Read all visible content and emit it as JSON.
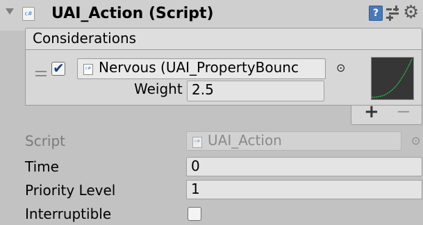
{
  "header": {
    "title": "UAI_Action (Script)",
    "script_icon_text": "c#",
    "icons": [
      "foldout-arrow-icon",
      "script-icon",
      "help-icon",
      "presets-icon",
      "gear-icon"
    ]
  },
  "considerations": {
    "header_label": "Considerations",
    "items": [
      {
        "enabled": true,
        "object_label": "Nervous (UAI_PropertyBounc",
        "object_icon_text": "c#",
        "weight_label": "Weight",
        "weight_value": "2.5"
      }
    ],
    "add_label": "+",
    "remove_label": "−"
  },
  "properties": {
    "script_label": "Script",
    "script_value": "UAI_Action",
    "time_label": "Time",
    "time_value": "0",
    "priority_label": "Priority Level",
    "priority_value": "1",
    "interruptible_label": "Interruptible",
    "interruptible_checked": false
  },
  "colors": {
    "inspector_bg": "#c2c2c2",
    "header_bg": "#cfcfcf",
    "curve_bg": "#363636",
    "curve_line": "#2fb84a",
    "checkmark": "#1d3f78",
    "help_icon": "#4a79b7"
  }
}
